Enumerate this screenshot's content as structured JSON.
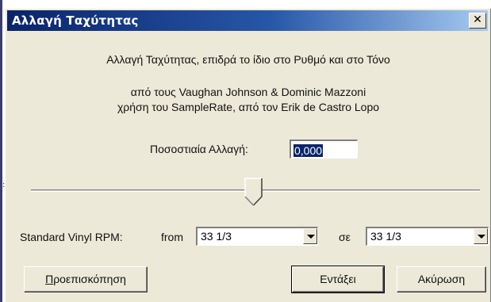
{
  "dialog": {
    "title": "Αλλαγή Ταχύτητας",
    "close_glyph": "✕"
  },
  "content": {
    "description": "Αλλαγή Ταχύτητας, επιδρά το ίδιο στο Ρυθμό και στο Τόνο",
    "credits_line1": "από τους Vaughan Johnson & Dominic Mazzoni",
    "credits_line2": "χρήση του SampleRate, από τον Erik de Castro Lopo"
  },
  "percent_change": {
    "label": "Ποσοστιαία Αλλαγή:",
    "value": "0,000"
  },
  "slider": {
    "value_fraction": 0.5
  },
  "vinyl_rpm": {
    "label": "Standard Vinyl RPM:",
    "from_label": "from",
    "from_value": "33 1/3",
    "to_label": "σε",
    "to_value": "33 1/3"
  },
  "buttons": {
    "preview": "Προεπισκόπηση",
    "ok": "Εντάξει",
    "cancel": "Ακύρωση"
  },
  "left_edge_glyph": ":"
}
